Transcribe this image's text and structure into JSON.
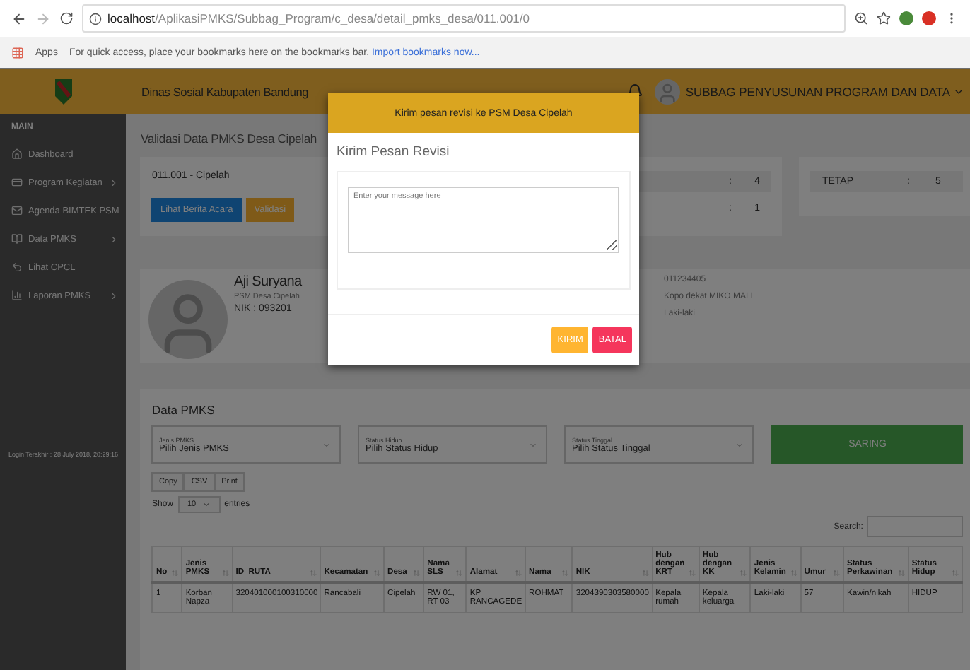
{
  "browser": {
    "url_host": "localhost",
    "url_path": "/AplikasiPMKS/Subbag_Program/c_desa/detail_pmks_desa/011.001/0",
    "apps_label": "Apps",
    "bookmarks_hint": "For quick access, place your bookmarks here on the bookmarks bar.",
    "import_link": "Import bookmarks now..."
  },
  "topbar": {
    "title": "Dinas Sosial Kabupaten Bandung",
    "user": "SUBBAG PENYUSUNAN PROGRAM DAN DATA"
  },
  "sidebar": {
    "section": "MAIN",
    "items": [
      {
        "label": "Dashboard",
        "has_submenu": false
      },
      {
        "label": "Program Kegiatan",
        "has_submenu": true
      },
      {
        "label": "Agenda BIMTEK PSM",
        "has_submenu": false
      },
      {
        "label": "Data PMKS",
        "has_submenu": true
      },
      {
        "label": "Lihat CPCL",
        "has_submenu": false
      },
      {
        "label": "Laporan PMKS",
        "has_submenu": true
      }
    ],
    "footer": "Login Terakhir : 28 July 2018, 20:29:16"
  },
  "page": {
    "title": "Validasi Data PMKS Desa Cipelah",
    "village": "011.001 - Cipelah",
    "buttons": [
      {
        "label": "Lihat Berita Acara",
        "kind": "primary"
      },
      {
        "label": "Validasi",
        "kind": "warning"
      }
    ],
    "stats": [
      {
        "separator": ":",
        "value": "4"
      },
      {
        "separator": ":",
        "value": "1"
      }
    ],
    "stats_right": [
      {
        "label": "TETAP",
        "separator": ":",
        "value": "5"
      }
    ]
  },
  "profile": {
    "name": "Aji Suryana",
    "role": "PSM Desa Cipelah",
    "nik": "NIK : 093201",
    "details": [
      "011234405",
      "Kopo dekat MIKO MALL",
      "Laki-laki"
    ]
  },
  "data_pmks": {
    "title": "Data PMKS",
    "filters": [
      {
        "label": "Jenis PMKS",
        "value": "Pilih Jenis PMKS"
      },
      {
        "label": "Status Hidup",
        "value": "Pilih Status Hidup"
      },
      {
        "label": "Status Tinggal",
        "value": "Pilih Status Tinggal"
      }
    ],
    "filter_button": "SARING",
    "export_buttons": [
      "Copy",
      "CSV",
      "Print"
    ],
    "show_label": "Show",
    "page_size": "10",
    "entries_label": "entries",
    "search_label": "Search:",
    "table": {
      "columns": [
        "No",
        "Jenis PMKS",
        "ID_RUTA",
        "Kecamatan",
        "Desa",
        "Nama SLS",
        "Alamat",
        "Nama",
        "NIK",
        "Hub dengan KRT",
        "Hub dengan KK",
        "Jenis Kelamin",
        "Umur",
        "Status Perkawinan",
        "Status Hidup"
      ],
      "rows": [
        [
          "1",
          "Korban Napza",
          "320401000100310000",
          "Rancabali",
          "Cipelah",
          "RW 01, RT 03",
          "KP RANCAGEDE",
          "ROHMAT",
          "3204390303580000",
          "Kepala rumah",
          "Kepala keluarga",
          "Laki-laki",
          "57",
          "Kawin/nikah",
          "HIDUP"
        ]
      ]
    }
  },
  "modal": {
    "title": "Kirim pesan revisi ke PSM Desa Cipelah",
    "heading": "Kirim Pesan Revisi",
    "placeholder": "Enter your message here",
    "buttons": [
      {
        "label": "KIRIM",
        "kind": "warning"
      },
      {
        "label": "BATAL",
        "kind": "danger"
      }
    ]
  }
}
